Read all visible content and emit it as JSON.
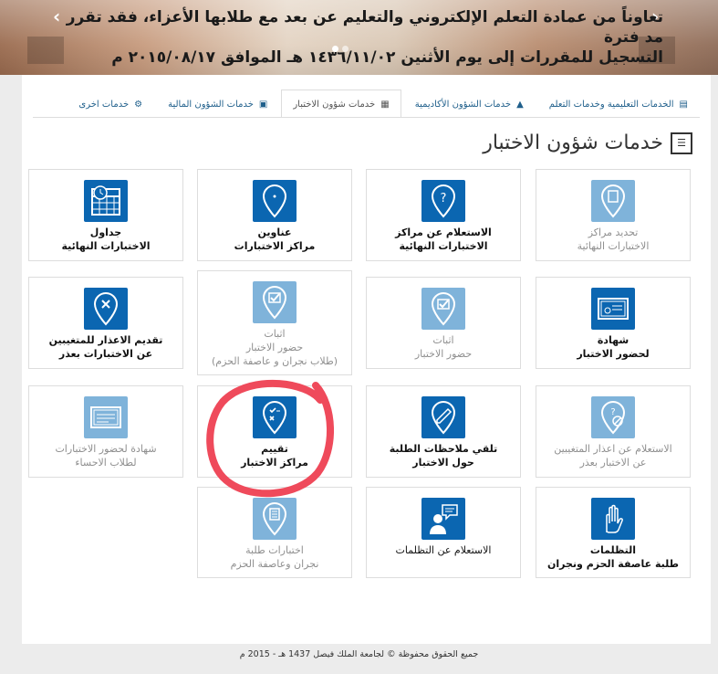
{
  "banner": {
    "line1": "تعاوناً من عمادة التعلم الإلكتروني والتعليم عن بعد مع طلابها الأعزاء، فقد تقرر مد فترة",
    "line2": "التسجيل للمقررات إلى يوم الأثنين ١٤٣٦/١١/٠٢ هـ الموافق ٢٠١٥/٠٨/١٧ م",
    "prev": "‹",
    "next": "›"
  },
  "tabs": [
    {
      "label": "الخدمات التعليمية وخدمات التعلم",
      "icon": "document-icon"
    },
    {
      "label": "خدمات الشؤون الأكاديمية",
      "icon": "graduation-cap-icon"
    },
    {
      "label": "خدمات شؤون الاختبار",
      "icon": "exam-icon"
    },
    {
      "label": "خدمات الشؤون المالية",
      "icon": "money-icon"
    },
    {
      "label": "خدمات اخرى",
      "icon": "gear-icon"
    }
  ],
  "page_title": "خدمات شؤون الاختبار",
  "cards": {
    "c1": {
      "l1": "تحديد مراكز",
      "l2": "الاختبارات النهائية",
      "icon": "location-pin-icon",
      "enabled": false
    },
    "c2": {
      "l1": "الاستعلام عن مراكز",
      "l2": "الاختبارات النهائية",
      "icon": "question-pin-icon",
      "enabled": true
    },
    "c3": {
      "l1": "عناوين",
      "l2": "مراكز الاختبارات",
      "icon": "location-pin-icon",
      "enabled": true
    },
    "c4": {
      "l1": "جداول",
      "l2": "الاختبارات النهائية",
      "icon": "calendar-clock-icon",
      "enabled": true
    },
    "c5": {
      "l1": "شهادة",
      "l2": "لحضور الاختبار",
      "icon": "certificate-icon",
      "enabled": true
    },
    "c6": {
      "l1": "اثبات",
      "l2": "حضور الاختبار",
      "icon": "check-pin-icon",
      "enabled": false
    },
    "c7": {
      "l1": "اثبات",
      "l2": "حضور الاختبار",
      "l3": "(طلاب نجران و عاصفة الحزم)",
      "icon": "check-pin-icon",
      "enabled": false
    },
    "c8": {
      "l1": "تقديم الاعذار للمتغيبين",
      "l2": "عن الاختبارات بعذر",
      "icon": "pin-x-icon",
      "enabled": true
    },
    "c9": {
      "l1": "الاستعلام عن اعذار المتغيبين",
      "l2": "عن الاختبار بعذر",
      "icon": "question-block-pin-icon",
      "enabled": false
    },
    "c10": {
      "l1": "تلقي ملاحظات الطلبة",
      "l2": "حول الاختبار",
      "icon": "pen-pin-icon",
      "enabled": true
    },
    "c11": {
      "l1": "تقييم",
      "l2": "مراكز الاختبار",
      "icon": "evaluate-pin-icon",
      "enabled": true
    },
    "c12": {
      "l1": "شهادة لحضور الاختبارات",
      "l2": "لطلاب الاحساء",
      "icon": "certificate-icon",
      "enabled": false
    },
    "c13": {
      "l1": "التظلمات",
      "l2": "طلبة عاصفة الحزم ونجران",
      "icon": "hand-icon",
      "enabled": true
    },
    "c14": {
      "l1": "الاستعلام عن التظلمات",
      "l2": "",
      "icon": "person-speech-icon",
      "enabled": true
    },
    "c15": {
      "l1": "اختبارات طلبة",
      "l2": "نجران وعاصفة الحزم",
      "icon": "list-pin-icon",
      "enabled": false
    }
  },
  "footer": "جميع الحقوق محفوظة © لجامعة الملك فيصل 1437 هـ - 2015 م",
  "colors": {
    "enabled_tile": "#0b66b1",
    "disabled_tile": "#7fb3da",
    "annotation": "#ef4a5b"
  }
}
